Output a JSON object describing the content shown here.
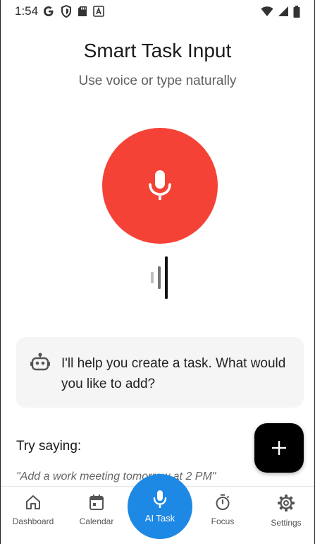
{
  "status_bar": {
    "time": "1:54",
    "left_icons": [
      "google-icon",
      "shield-icon",
      "sd-card-icon",
      "a-box-icon"
    ],
    "right_icons": [
      "wifi-icon",
      "signal-icon",
      "battery-icon"
    ]
  },
  "header": {
    "title": "Smart Task Input",
    "subtitle": "Use voice or type naturally"
  },
  "mic": {
    "icon": "microphone-icon",
    "color": "#f44336"
  },
  "assistant": {
    "icon": "robot-icon",
    "message": "I'll help you create a task. What would you like to add?"
  },
  "suggestions": {
    "label": "Try saying:",
    "example": "\"Add a work meeting tomorrow at 2 PM\""
  },
  "fab": {
    "icon": "plus-icon"
  },
  "bottom_nav": {
    "items": [
      {
        "label": "Dashboard",
        "icon": "home-icon"
      },
      {
        "label": "Calendar",
        "icon": "calendar-icon"
      },
      {
        "label": "AI Task",
        "icon": "microphone-icon",
        "active": true,
        "color": "#1e88e5"
      },
      {
        "label": "Focus",
        "icon": "timer-icon"
      },
      {
        "label": "Settings",
        "icon": "gear-icon"
      }
    ]
  }
}
